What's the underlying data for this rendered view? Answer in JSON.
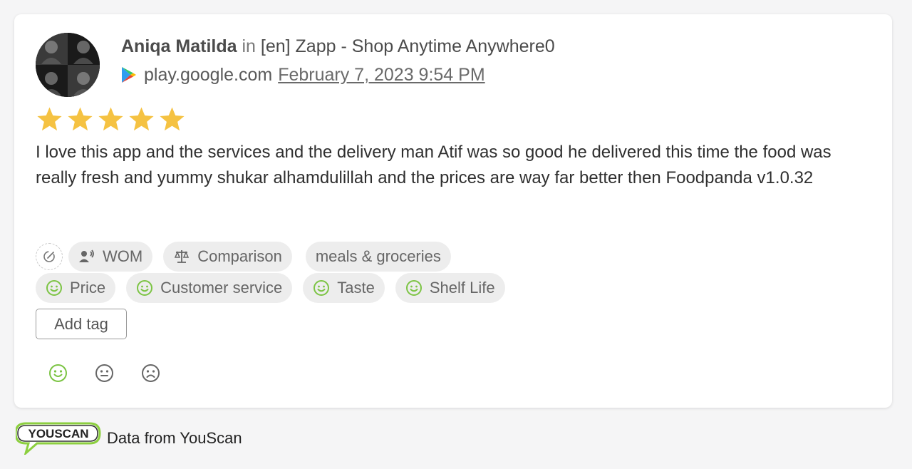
{
  "review": {
    "author": "Aniqa Matilda",
    "in_word": "in",
    "source_name": "[en] Zapp - Shop Anytime Anywhere0",
    "domain": "play.google.com",
    "date": "February 7, 2023 9:54 PM",
    "rating": 5,
    "rating_max": 5,
    "text": "I love this app and the services and the delivery man Atif was so good he delivered this time the food was really fresh and yummy shukar alhamdulillah and the prices are way far better then Foodpanda v1.0.32"
  },
  "tags": {
    "row1": [
      {
        "label": "WOM",
        "icon": "megaphone-person-icon"
      },
      {
        "label": "Comparison",
        "icon": "scales-icon"
      },
      {
        "label": "meals & groceries",
        "icon": ""
      }
    ],
    "row2": [
      {
        "label": "Price",
        "icon": "smile-icon"
      },
      {
        "label": "Customer service",
        "icon": "smile-icon"
      },
      {
        "label": "Taste",
        "icon": "smile-icon"
      },
      {
        "label": "Shelf Life",
        "icon": "smile-icon"
      }
    ],
    "add_tag_label": "Add tag"
  },
  "sentiment": {
    "options": [
      "positive",
      "neutral",
      "negative"
    ],
    "selected": "positive"
  },
  "footer": {
    "logo_text": "YOUSCAN",
    "text": "Data from YouScan"
  },
  "colors": {
    "star": "#f5c242",
    "positive": "#7cc444",
    "tag_bg": "#ededed",
    "logo_green": "#8ccf3f"
  }
}
